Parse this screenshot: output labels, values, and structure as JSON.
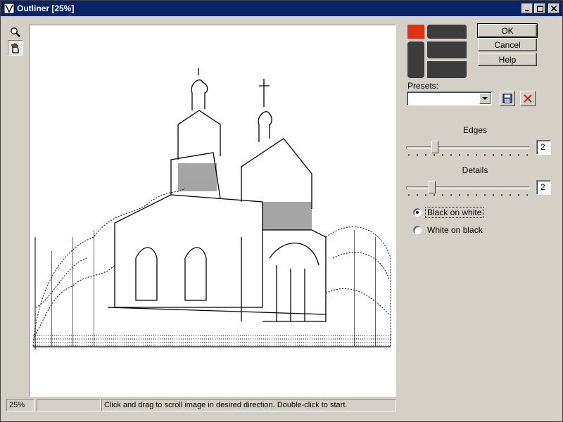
{
  "window": {
    "title": "Outliner [25%]"
  },
  "tools": {
    "zoom": "magnifier-icon",
    "pan": "hand-icon"
  },
  "buttons": {
    "ok": "OK",
    "cancel": "Cancel",
    "help": "Help"
  },
  "presets": {
    "label": "Presets:",
    "value": "",
    "save_icon": "save-icon",
    "delete_icon": "delete-icon"
  },
  "edges": {
    "label": "Edges",
    "value": "2"
  },
  "details": {
    "label": "Details",
    "value": "2"
  },
  "mode": {
    "options": [
      {
        "label": "Black on white",
        "checked": true
      },
      {
        "label": "White on black",
        "checked": false
      }
    ]
  },
  "status": {
    "zoom": "25%",
    "progress": "",
    "message": "Click and drag to scroll image in desired direction. Double-click to start."
  },
  "colors": {
    "titlebar": "#0a246a",
    "logo_dark": "#3c3c3c",
    "logo_accent": "#e03010"
  }
}
